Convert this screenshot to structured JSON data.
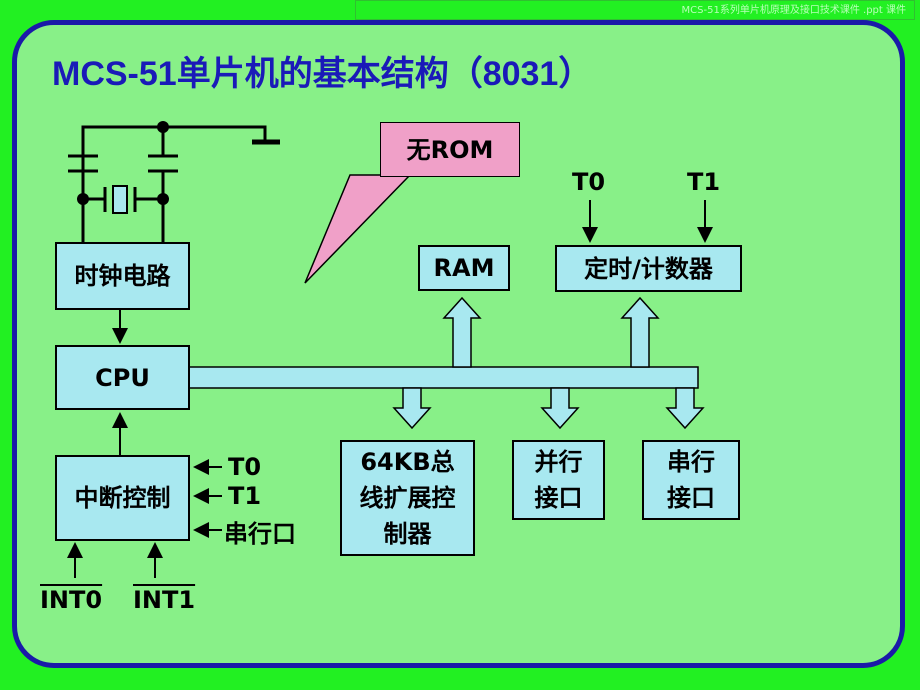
{
  "watermark": "MCS-51系列单片机原理及接口技术课件 .ppt 课件",
  "title": "MCS-51单片机的基本结构（8031）",
  "callout": "无ROM",
  "blocks": {
    "clock": "时钟电路",
    "cpu": "CPU",
    "interrupt": "中断控制",
    "ram": "RAM",
    "timer": "定时/计数器",
    "bus_ext": "64KB总线扩展控制器",
    "parallel": "并行接口",
    "serial": "串行接口"
  },
  "timer_inputs": [
    "T0",
    "T1"
  ],
  "interrupt_inputs": [
    "T0",
    "T1",
    "串行口"
  ],
  "external_interrupts": [
    "INT0",
    "INT1"
  ],
  "colors": {
    "title": "#1a1ab8",
    "box": "#a8e8f0",
    "callout": "#f0a0c8",
    "panel": "#88f088",
    "border": "#1a1aa8"
  }
}
